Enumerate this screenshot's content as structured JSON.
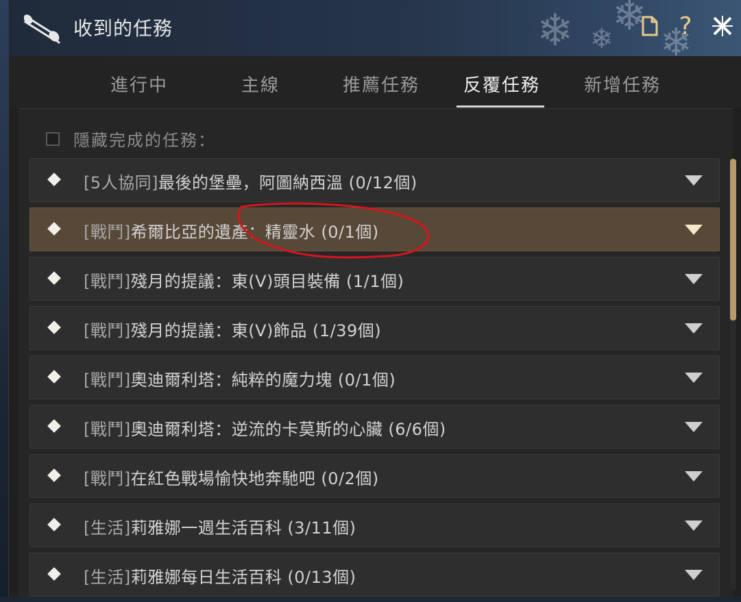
{
  "window": {
    "title": "收到的任務",
    "icon": "scroll-icon",
    "buttons": [
      {
        "name": "document-icon",
        "glyph": "🗋"
      },
      {
        "name": "help-icon",
        "glyph": "?"
      },
      {
        "name": "close-icon",
        "glyph": "✕"
      }
    ]
  },
  "tabs": [
    {
      "label": "進行中",
      "active": false
    },
    {
      "label": "主線",
      "active": false
    },
    {
      "label": "推薦任務",
      "active": false
    },
    {
      "label": "反覆任務",
      "active": true
    },
    {
      "label": "新增任務",
      "active": false
    }
  ],
  "filter": {
    "hide_completed_label": "隱藏完成的任務：",
    "checked": false
  },
  "quests": [
    {
      "tag": "[5人協同]",
      "name": "最後的堡壘，阿圖納西溫",
      "progress": "(0/12個)",
      "highlighted": false
    },
    {
      "tag": "[戰鬥]",
      "name": "希爾比亞的遺產：精靈水",
      "progress": "(0/1個)",
      "highlighted": true
    },
    {
      "tag": "[戰鬥]",
      "name": "殘月的提議：東(V)頭目裝備",
      "progress": "(1/1個)",
      "highlighted": false
    },
    {
      "tag": "[戰鬥]",
      "name": "殘月的提議：東(V)飾品",
      "progress": "(1/39個)",
      "highlighted": false
    },
    {
      "tag": "[戰鬥]",
      "name": "奧迪爾利塔：純粹的魔力塊",
      "progress": "(0/1個)",
      "highlighted": false
    },
    {
      "tag": "[戰鬥]",
      "name": "奧迪爾利塔：逆流的卡莫斯的心臟",
      "progress": "(6/6個)",
      "highlighted": false
    },
    {
      "tag": "[戰鬥]",
      "name": "在紅色戰場愉快地奔馳吧",
      "progress": "(0/2個)",
      "highlighted": false
    },
    {
      "tag": "[生活]",
      "name": "莉雅娜一週生活百科",
      "progress": "(3/11個)",
      "highlighted": false
    },
    {
      "tag": "[生活]",
      "name": "莉雅娜每日生活百科",
      "progress": "(0/13個)",
      "highlighted": false
    }
  ],
  "colors": {
    "accent_gold": "#e8c98c",
    "highlight_row": "#574838",
    "annotation_red": "#d8141c"
  }
}
